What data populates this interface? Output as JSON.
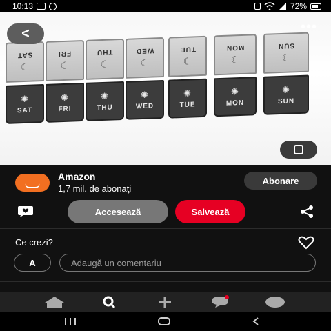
{
  "status_bar": {
    "time": "10:13",
    "battery": "72%",
    "left_icons": [
      "image-icon",
      "whatsapp-icon"
    ],
    "right_icons": [
      "lock-icon",
      "wifi-icon",
      "signal-icon",
      "battery-icon"
    ]
  },
  "pin": {
    "back_label": "<",
    "more_label": "•••",
    "days_lid": [
      "SAT",
      "FRI",
      "THU",
      "WED",
      "TUE",
      "MON",
      "SUN"
    ],
    "days_base": [
      "SAT",
      "FRI",
      "THU",
      "WED",
      "TUE",
      "MON",
      "SUN"
    ]
  },
  "creator": {
    "name": "Amazon",
    "subscribers": "1,7 mil. de abonaţi",
    "follow_label": "Abonare"
  },
  "actions": {
    "visit_label": "Accesează",
    "save_label": "Salvează"
  },
  "comments": {
    "question": "Ce crezi?",
    "user_initial": "A",
    "placeholder": "Adaugă un comentariu"
  },
  "bottom_nav": [
    "home-icon",
    "search-icon",
    "plus-icon",
    "messages-icon",
    "profile-icon"
  ],
  "colors": {
    "save_red": "#e60023",
    "amazon_orange": "#f26f21",
    "visit_gray": "#777777"
  }
}
